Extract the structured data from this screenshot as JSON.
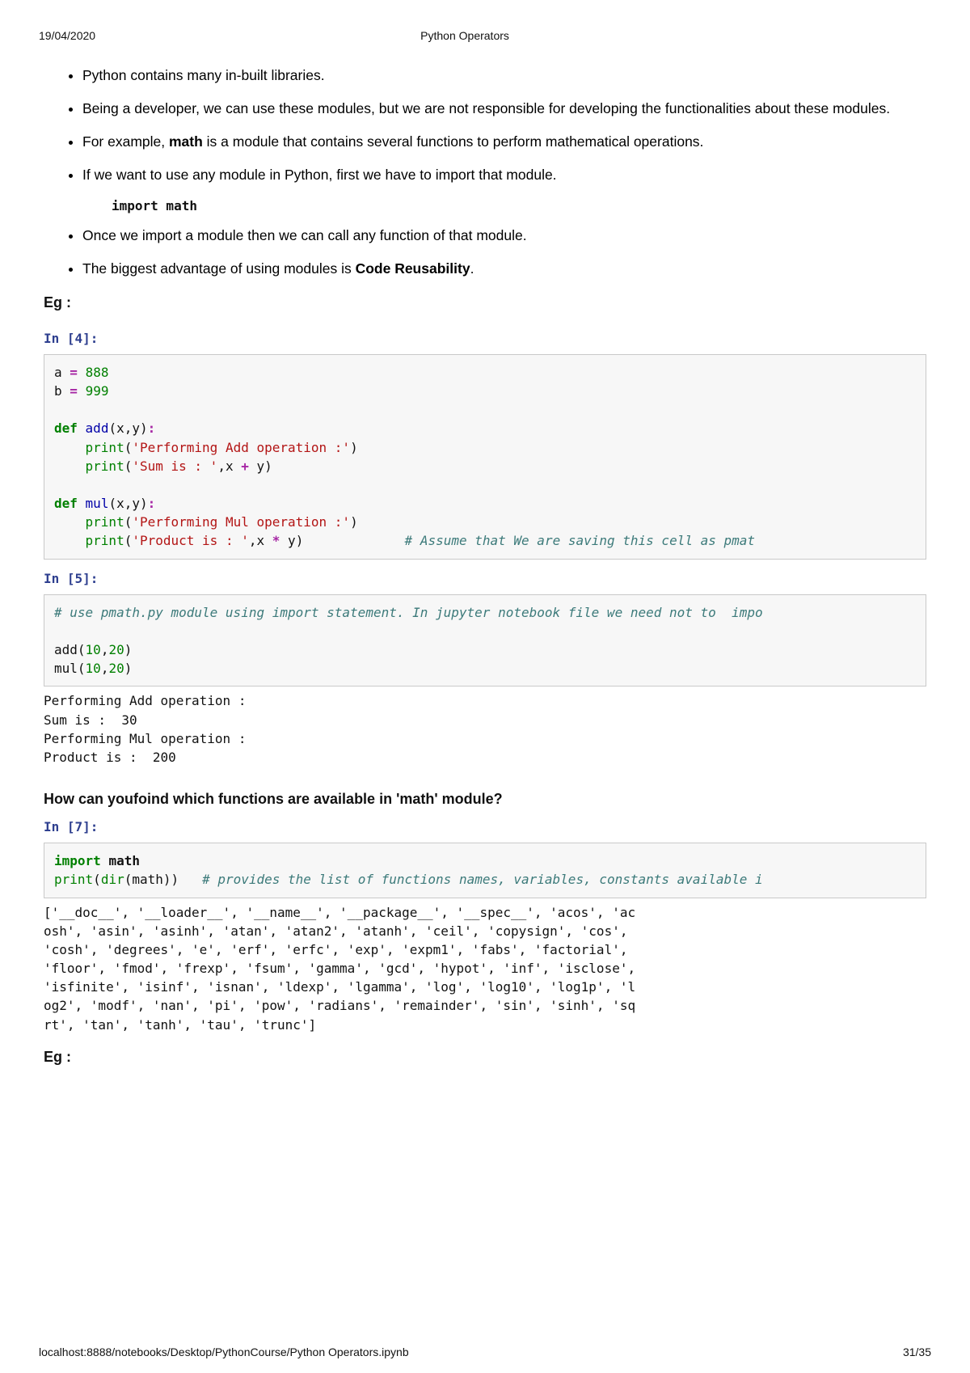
{
  "header": {
    "date": "19/04/2020",
    "title": "Python Operators"
  },
  "bullets_top": [
    "Python contains many in-built libraries.",
    "Being a developer, we can use these modules, but we are not responsible for developing the functionalities about these modules."
  ],
  "bullet_math_pre": "For example, ",
  "bullet_math_bold": "math",
  "bullet_math_post": " is a module that contains several functions to perform mathematical operations.",
  "bullet_import": "If we want to use any module in Python, first we have to import that module.",
  "import_line": "import math",
  "bullets_after": [
    "Once we import a module then we can call any function of that module."
  ],
  "bullet_reuse_pre": "The biggest advantage of using modules is ",
  "bullet_reuse_bold": "Code Reusability",
  "bullet_reuse_post": ".",
  "eg_label": "Eg :",
  "cell4": {
    "prompt": "In [4]:",
    "a_var": "a",
    "a_val": "888",
    "b_var": "b",
    "b_val": "999",
    "fn1": "add",
    "args1": "(x,y)",
    "fn1_print1_str": "'Performing Add operation :'",
    "fn1_sum_str": "'Sum is : '",
    "fn1_expr_a": "x",
    "fn1_expr_b": "y",
    "fn2": "mul",
    "args2": "(x,y)",
    "fn2_print1_str": "'Performing Mul operation :'",
    "fn2_prod_str": "'Product is : '",
    "fn2_expr_a": "x",
    "fn2_expr_b": "y",
    "comment": "# Assume that We are saving this cell as pmat"
  },
  "cell5": {
    "prompt": "In [5]:",
    "comment": "# use pmath.py module using import statement. In jupyter notebook file we need not to  impo",
    "call1_name": "add",
    "call1_a": "10",
    "call1_b": "20",
    "call2_name": "mul",
    "call2_a": "10",
    "call2_b": "20",
    "output": "Performing Add operation :\nSum is :  30\nPerforming Mul operation :\nProduct is :  200"
  },
  "heading_find": "How can youfoind which functions are available in 'math' module?",
  "cell7": {
    "prompt": "In [7]:",
    "import_kw": "import",
    "import_mod": "math",
    "call_name": "print",
    "builtin": "dir",
    "arg": "math",
    "comment": "# provides the list of functions names, variables, constants available i",
    "output": "['__doc__', '__loader__', '__name__', '__package__', '__spec__', 'acos', 'ac\nosh', 'asin', 'asinh', 'atan', 'atan2', 'atanh', 'ceil', 'copysign', 'cos',\n'cosh', 'degrees', 'e', 'erf', 'erfc', 'exp', 'expm1', 'fabs', 'factorial',\n'floor', 'fmod', 'frexp', 'fsum', 'gamma', 'gcd', 'hypot', 'inf', 'isclose',\n'isfinite', 'isinf', 'isnan', 'ldexp', 'lgamma', 'log', 'log10', 'log1p', 'l\nog2', 'modf', 'nan', 'pi', 'pow', 'radians', 'remainder', 'sin', 'sinh', 'sq\nrt', 'tan', 'tanh', 'tau', 'trunc']"
  },
  "eg2_label": "Eg :",
  "footer": {
    "url": "localhost:8888/notebooks/Desktop/PythonCourse/Python Operators.ipynb",
    "page": "31/35"
  }
}
